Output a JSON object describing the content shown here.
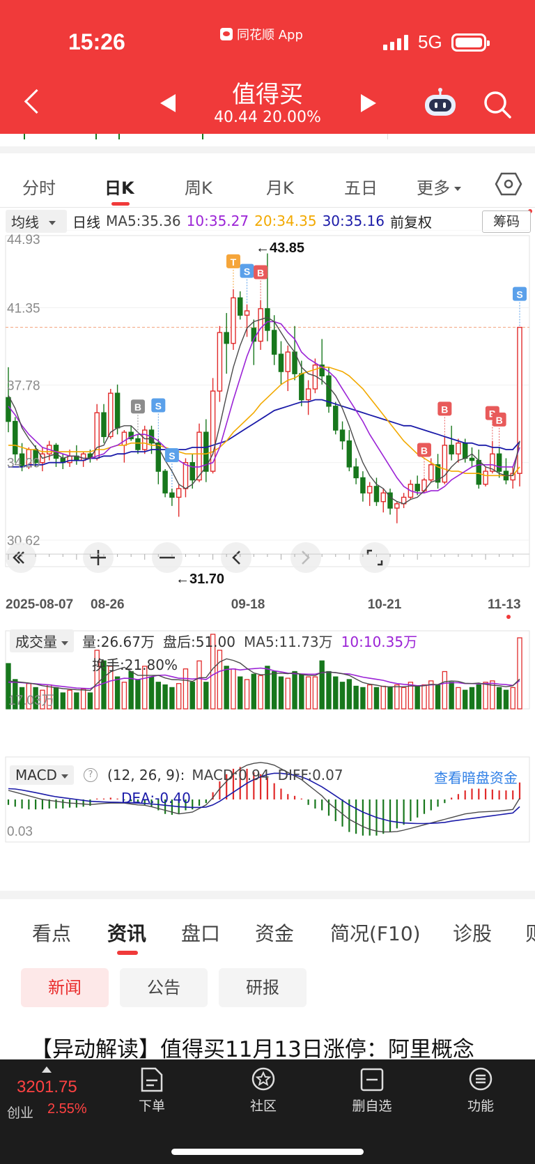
{
  "status_bar": {
    "time": "15:26",
    "app_name": "同花顺 App",
    "network": "5G"
  },
  "header": {
    "stock_name": "值得买",
    "stock_price_line": "40.44 20.00%"
  },
  "kline_tabs": [
    "分时",
    "日K",
    "周K",
    "月K",
    "五日",
    "更多"
  ],
  "active_kline_tab": "日K",
  "ma_row": {
    "dropdown": "均线",
    "period": "日线",
    "ma5": "MA5:35.36",
    "ma10": "10:35.27",
    "ma20": "20:34.35",
    "ma30": "30:35.16",
    "adjust": "前复权",
    "chips_button": "筹码"
  },
  "price_chart": {
    "y_labels": [
      "44.93",
      "41.35",
      "37.78",
      "34.20",
      "30.62"
    ],
    "high_label": "←43.85",
    "low_label": "←31.70",
    "x_labels": [
      "2025-08-07",
      "08-26",
      "09-18",
      "10-21",
      "11-13"
    ]
  },
  "volume_row": {
    "dropdown": "成交量",
    "volume": "量:26.67万",
    "after_hours": "盘后:51.00",
    "ma5": "MA5:11.73万",
    "ma10": "10:10.35万",
    "turnover": "换手:21.80%",
    "y_label": "17.03万"
  },
  "macd_row": {
    "dropdown": "MACD",
    "params": "(12, 26, 9):",
    "macd": "MACD:0.94",
    "diff": "DIFF:0.07",
    "dea": "DEA:-0.40",
    "link": "查看暗盘资金",
    "y_label": "0.03"
  },
  "section_tabs": [
    "看点",
    "资讯",
    "盘口",
    "资金",
    "简况(F10)",
    "诊股",
    "则"
  ],
  "active_section_tab": "资讯",
  "news_pills": [
    "新闻",
    "公告",
    "研报"
  ],
  "active_news_pill": "新闻",
  "headline": "【异动解读】值得买11月13日涨停：阿里概念",
  "bottom_bar": {
    "index_value": "3201.75",
    "index_name": "创业",
    "index_change": "2.55%",
    "nav": [
      "下单",
      "社区",
      "删自选",
      "功能"
    ]
  },
  "colors": {
    "up": "#e12b2b",
    "down": "#17771c",
    "ma5": "#4a4a4a",
    "ma10": "#9b23d6",
    "ma20": "#f2a900",
    "ma30": "#1a1aa8",
    "brand": "#f03a3a"
  },
  "chart_data": {
    "type": "candlestick",
    "dates_shown": [
      "2025-08-07",
      "08-26",
      "09-18",
      "10-21",
      "11-13"
    ],
    "candles": [
      [
        37.2,
        38.6,
        35.6,
        36.1
      ],
      [
        36.1,
        36.3,
        34.2,
        34.6
      ],
      [
        34.6,
        35.1,
        33.8,
        34.0
      ],
      [
        34.0,
        34.9,
        33.9,
        34.8
      ],
      [
        34.8,
        35.0,
        34.0,
        34.2
      ],
      [
        34.2,
        34.9,
        33.8,
        34.6
      ],
      [
        34.6,
        35.2,
        34.3,
        35.0
      ],
      [
        35.0,
        35.1,
        34.0,
        34.4
      ],
      [
        34.4,
        34.6,
        33.9,
        34.2
      ],
      [
        34.2,
        34.8,
        34.0,
        34.5
      ],
      [
        34.5,
        35.0,
        34.1,
        34.3
      ],
      [
        34.3,
        34.7,
        34.0,
        34.6
      ],
      [
        34.6,
        34.8,
        34.2,
        34.4
      ],
      [
        34.4,
        36.9,
        34.3,
        36.5
      ],
      [
        36.5,
        36.9,
        35.1,
        35.4
      ],
      [
        35.4,
        37.6,
        35.3,
        37.4
      ],
      [
        37.4,
        37.8,
        35.5,
        35.8
      ],
      [
        35.0,
        35.7,
        34.2,
        35.6
      ],
      [
        35.6,
        35.9,
        35.2,
        35.3
      ],
      [
        35.3,
        35.5,
        34.6,
        34.8
      ],
      [
        34.8,
        35.9,
        34.6,
        35.7
      ],
      [
        35.7,
        35.9,
        34.6,
        35.1
      ],
      [
        35.1,
        35.3,
        33.2,
        33.8
      ],
      [
        33.8,
        33.9,
        32.6,
        32.8
      ],
      [
        32.8,
        33.0,
        32.2,
        32.6
      ],
      [
        32.6,
        33.2,
        31.7,
        33.0
      ],
      [
        33.0,
        34.4,
        32.6,
        34.2
      ],
      [
        34.2,
        34.6,
        33.0,
        33.4
      ],
      [
        33.4,
        36.0,
        33.3,
        35.6
      ],
      [
        35.6,
        36.2,
        33.3,
        33.8
      ],
      [
        33.8,
        38.1,
        33.7,
        37.5
      ],
      [
        37.5,
        40.5,
        37.0,
        40.2
      ],
      [
        40.2,
        41.1,
        38.3,
        39.7
      ],
      [
        39.7,
        42.2,
        39.4,
        41.8
      ],
      [
        41.8,
        42.1,
        40.8,
        41.0
      ],
      [
        41.0,
        41.5,
        40.0,
        41.2
      ],
      [
        40.4,
        40.8,
        38.7,
        39.8
      ],
      [
        39.8,
        41.7,
        39.4,
        41.3
      ],
      [
        41.3,
        43.85,
        39.8,
        40.3
      ],
      [
        40.3,
        41.0,
        38.7,
        39.2
      ],
      [
        39.2,
        39.8,
        37.8,
        38.4
      ],
      [
        38.4,
        39.6,
        37.5,
        39.3
      ],
      [
        39.3,
        40.5,
        38.0,
        38.3
      ],
      [
        38.3,
        38.9,
        36.8,
        37.1
      ],
      [
        37.1,
        38.0,
        36.4,
        37.6
      ],
      [
        37.6,
        39.0,
        37.4,
        38.7
      ],
      [
        38.7,
        39.9,
        37.8,
        38.2
      ],
      [
        38.2,
        38.6,
        36.5,
        36.8
      ],
      [
        36.8,
        37.0,
        35.5,
        35.7
      ],
      [
        35.7,
        36.1,
        34.8,
        35.2
      ],
      [
        35.2,
        35.7,
        33.8,
        34.0
      ],
      [
        34.0,
        34.4,
        33.2,
        33.5
      ],
      [
        33.5,
        33.8,
        32.4,
        32.8
      ],
      [
        32.8,
        33.3,
        32.2,
        33.1
      ],
      [
        33.1,
        33.5,
        32.2,
        32.4
      ],
      [
        32.4,
        33.0,
        31.9,
        32.8
      ],
      [
        32.8,
        33.0,
        31.8,
        32.1
      ],
      [
        32.1,
        32.4,
        31.4,
        32.3
      ],
      [
        32.3,
        32.8,
        32.1,
        32.6
      ],
      [
        32.6,
        33.4,
        32.5,
        33.2
      ],
      [
        33.2,
        33.6,
        32.7,
        32.9
      ],
      [
        32.9,
        33.5,
        32.8,
        33.4
      ],
      [
        33.4,
        34.4,
        33.3,
        34.1
      ],
      [
        34.1,
        34.6,
        33.0,
        33.3
      ],
      [
        33.3,
        35.4,
        33.2,
        35.0
      ],
      [
        35.0,
        35.9,
        34.3,
        34.6
      ],
      [
        34.6,
        35.3,
        34.2,
        35.1
      ],
      [
        35.1,
        35.3,
        34.2,
        34.4
      ],
      [
        34.4,
        34.9,
        34.0,
        34.3
      ],
      [
        34.3,
        34.8,
        33.0,
        33.2
      ],
      [
        33.2,
        34.0,
        33.1,
        33.8
      ],
      [
        33.8,
        35.2,
        33.7,
        34.6
      ],
      [
        34.6,
        34.9,
        33.5,
        33.8
      ],
      [
        33.8,
        34.4,
        33.2,
        33.4
      ],
      [
        33.4,
        34.0,
        33.0,
        33.7
      ],
      [
        33.7,
        40.44,
        33.1,
        40.44
      ]
    ],
    "ma5": [
      37.3,
      36.7,
      35.8,
      35.3,
      34.9,
      34.4,
      34.5,
      34.6,
      34.4,
      34.5,
      34.5,
      34.4,
      34.4,
      34.9,
      35.0,
      35.6,
      35.8,
      35.9,
      35.9,
      35.6,
      35.3,
      35.3,
      34.9,
      34.3,
      33.8,
      33.2,
      33.0,
      33.2,
      33.6,
      34.0,
      34.6,
      35.9,
      37.3,
      38.6,
      39.6,
      40.4,
      40.7,
      40.8,
      40.9,
      40.7,
      40.2,
      39.7,
      39.3,
      38.6,
      38.3,
      38.2,
      38.0,
      37.7,
      37.3,
      36.7,
      35.9,
      35.0,
      34.2,
      33.6,
      33.2,
      33.0,
      32.6,
      32.4,
      32.3,
      32.5,
      32.6,
      32.9,
      33.3,
      33.4,
      33.6,
      34.0,
      34.3,
      34.4,
      34.6,
      34.3,
      34.0,
      33.9,
      33.7,
      33.6,
      33.6,
      35.2
    ],
    "ma10": [
      36.8,
      36.4,
      35.9,
      35.5,
      35.2,
      34.9,
      34.8,
      34.7,
      34.6,
      34.5,
      34.5,
      34.4,
      34.4,
      34.5,
      34.6,
      34.9,
      35.0,
      35.2,
      35.4,
      35.5,
      35.5,
      35.4,
      35.2,
      34.9,
      34.6,
      34.3,
      34.1,
      34.0,
      34.0,
      34.1,
      34.2,
      34.9,
      36.0,
      37.1,
      38.1,
      39.1,
      39.9,
      40.4,
      40.7,
      40.7,
      40.6,
      40.2,
      39.9,
      39.3,
      39.0,
      38.8,
      38.6,
      38.4,
      38.1,
      37.6,
      37.1,
      36.6,
      36.1,
      35.5,
      35.0,
      34.5,
      34.0,
      33.5,
      33.1,
      32.9,
      32.8,
      32.8,
      32.9,
      32.9,
      33.1,
      33.4,
      33.6,
      33.8,
      34.0,
      34.1,
      34.1,
      34.1,
      34.0,
      34.0,
      34.0,
      34.9
    ],
    "ma20": [
      35.0,
      35.0,
      34.9,
      34.8,
      34.8,
      34.7,
      34.7,
      34.7,
      34.7,
      34.7,
      34.7,
      34.7,
      34.7,
      34.8,
      34.8,
      34.9,
      35.0,
      35.0,
      35.1,
      35.1,
      35.1,
      35.0,
      35.0,
      34.9,
      34.8,
      34.7,
      34.6,
      34.6,
      34.6,
      34.6,
      34.7,
      34.9,
      35.2,
      35.6,
      35.9,
      36.2,
      36.5,
      36.9,
      37.2,
      37.5,
      37.8,
      38.0,
      38.1,
      38.3,
      38.4,
      38.5,
      38.6,
      38.6,
      38.5,
      38.4,
      38.2,
      37.9,
      37.6,
      37.2,
      36.8,
      36.4,
      36.0,
      35.6,
      35.2,
      34.9,
      34.6,
      34.4,
      34.2,
      34.0,
      33.9,
      33.8,
      33.8,
      33.7,
      33.7,
      33.7,
      33.6,
      33.6,
      33.6,
      33.6,
      33.6,
      34.0
    ],
    "ma30": [
      34.0,
      34.0,
      34.0,
      34.1,
      34.1,
      34.1,
      34.2,
      34.2,
      34.2,
      34.3,
      34.3,
      34.3,
      34.4,
      34.4,
      34.5,
      34.5,
      34.6,
      34.6,
      34.7,
      34.7,
      34.7,
      34.8,
      34.8,
      34.8,
      34.8,
      34.8,
      34.8,
      34.9,
      34.9,
      34.9,
      35.0,
      35.1,
      35.2,
      35.4,
      35.6,
      35.8,
      36.0,
      36.2,
      36.4,
      36.6,
      36.7,
      36.8,
      36.9,
      37.0,
      37.0,
      37.1,
      37.1,
      37.0,
      36.9,
      36.8,
      36.7,
      36.6,
      36.5,
      36.4,
      36.3,
      36.2,
      36.1,
      36.0,
      35.9,
      35.9,
      35.8,
      35.7,
      35.6,
      35.5,
      35.4,
      35.3,
      35.2,
      35.1,
      35.1,
      35.0,
      35.0,
      34.9,
      34.9,
      34.8,
      34.8,
      35.16
    ],
    "volume_wan": [
      17.0,
      11.0,
      8.0,
      9.5,
      8.0,
      7.0,
      9.0,
      8.0,
      6.0,
      7.0,
      6.0,
      7.5,
      6.0,
      22.0,
      18.0,
      16.0,
      12.0,
      10.0,
      14.0,
      11.0,
      16.0,
      12.0,
      10.0,
      9.0,
      8.0,
      9.5,
      15.0,
      10.0,
      18.0,
      10.0,
      28.0,
      22.0,
      16.0,
      15.0,
      12.0,
      11.0,
      13.0,
      12.5,
      16.0,
      14.0,
      12.0,
      11.5,
      14.0,
      13.0,
      12.0,
      12.0,
      18.0,
      14.0,
      12.0,
      10.0,
      11.0,
      8.5,
      8.0,
      9.0,
      8.0,
      8.5,
      8.0,
      9.0,
      8.0,
      10.0,
      8.5,
      9.0,
      10.5,
      9.0,
      14.0,
      10.0,
      8.0,
      7.0,
      8.0,
      9.0,
      10.0,
      10.5,
      8.0,
      7.0,
      8.0,
      26.67
    ],
    "vol_ma5": [
      10.5,
      10.2,
      10.0,
      9.7,
      9.3,
      8.7,
      8.3,
      8.0,
      7.6,
      7.4,
      7.2,
      7.1,
      6.9,
      9.5,
      11.9,
      13.9,
      14.8,
      15.6,
      14.0,
      12.6,
      12.6,
      12.6,
      12.6,
      11.6,
      11.0,
      10.9,
      10.7,
      10.3,
      11.7,
      11.7,
      15.1,
      17.6,
      18.8,
      18.2,
      17.2,
      15.2,
      13.5,
      12.8,
      12.9,
      13.3,
      13.4,
      13.2,
      13.6,
      12.9,
      12.6,
      12.5,
      13.8,
      13.8,
      13.6,
      13.2,
      12.6,
      11.2,
      9.9,
      9.3,
      8.9,
      8.4,
      8.3,
      8.3,
      8.3,
      8.6,
      8.5,
      8.7,
      9.2,
      9.1,
      10.2,
      10.5,
      10.3,
      9.6,
      9.5,
      9.7,
      9.2,
      8.9,
      8.7,
      8.3,
      8.7,
      11.2
    ],
    "vol_ma10": [
      10.0,
      10.0,
      9.8,
      9.6,
      9.4,
      9.2,
      9.0,
      8.7,
      8.4,
      8.1,
      7.8,
      7.7,
      7.6,
      8.7,
      9.6,
      10.5,
      11.0,
      11.5,
      11.4,
      11.0,
      11.5,
      12.1,
      12.6,
      12.7,
      12.1,
      11.5,
      11.4,
      11.2,
      11.4,
      11.0,
      12.8,
      14.1,
      14.8,
      15.0,
      14.6,
      14.9,
      15.1,
      15.3,
      15.0,
      14.3,
      13.9,
      13.4,
      13.2,
      13.1,
      13.0,
      13.0,
      13.6,
      13.8,
      13.6,
      13.2,
      13.1,
      12.5,
      11.9,
      11.5,
      11.1,
      10.7,
      10.0,
      9.5,
      9.2,
      9.0,
      8.7,
      8.8,
      9.0,
      9.1,
      9.6,
      9.8,
      9.8,
      9.5,
      9.5,
      9.4,
      9.5,
      9.6,
      9.3,
      9.1,
      8.8,
      10.6
    ],
    "macd_hist": [
      -0.3,
      -0.4,
      -0.5,
      -0.55,
      -0.55,
      -0.55,
      -0.5,
      -0.5,
      -0.5,
      -0.45,
      -0.45,
      -0.4,
      -0.35,
      0.05,
      0.05,
      0.1,
      0.05,
      -0.05,
      -0.1,
      -0.2,
      -0.3,
      -0.4,
      -0.6,
      -0.8,
      -0.85,
      -0.8,
      -0.6,
      -0.55,
      -0.35,
      -0.2,
      0.4,
      1.0,
      1.4,
      1.7,
      1.8,
      1.7,
      1.5,
      1.4,
      1.2,
      0.9,
      0.6,
      0.3,
      0.2,
      0.05,
      -0.3,
      -0.5,
      -0.6,
      -0.9,
      -1.2,
      -1.5,
      -1.8,
      -1.9,
      -2.0,
      -2.0,
      -2.0,
      -1.9,
      -1.8,
      -1.6,
      -1.4,
      -1.2,
      -1.0,
      -0.8,
      -0.6,
      -0.4,
      -0.2,
      0.1,
      0.3,
      0.5,
      0.6,
      0.6,
      0.6,
      0.55,
      0.5,
      0.5,
      0.5,
      0.94
    ],
    "diff": [
      0.5,
      0.4,
      0.3,
      0.2,
      0.1,
      0.0,
      -0.05,
      -0.1,
      -0.15,
      -0.2,
      -0.22,
      -0.25,
      -0.28,
      -0.25,
      -0.22,
      -0.2,
      -0.2,
      -0.2,
      -0.25,
      -0.3,
      -0.32,
      -0.4,
      -0.5,
      -0.6,
      -0.7,
      -0.8,
      -0.75,
      -0.7,
      -0.5,
      -0.3,
      0.1,
      0.6,
      1.0,
      1.4,
      1.7,
      1.9,
      2.0,
      2.05,
      2.0,
      1.9,
      1.7,
      1.5,
      1.3,
      1.1,
      0.8,
      0.5,
      0.2,
      -0.2,
      -0.5,
      -0.8,
      -1.1,
      -1.3,
      -1.5,
      -1.65,
      -1.75,
      -1.8,
      -1.8,
      -1.78,
      -1.7,
      -1.6,
      -1.5,
      -1.4,
      -1.3,
      -1.2,
      -1.1,
      -1.0,
      -0.9,
      -0.8,
      -0.75,
      -0.7,
      -0.68,
      -0.66,
      -0.64,
      -0.6,
      -0.55,
      0.07
    ],
    "dea": [
      0.6,
      0.58,
      0.52,
      0.45,
      0.38,
      0.3,
      0.22,
      0.15,
      0.1,
      0.05,
      0.0,
      -0.05,
      -0.1,
      -0.12,
      -0.14,
      -0.15,
      -0.16,
      -0.17,
      -0.18,
      -0.2,
      -0.22,
      -0.25,
      -0.28,
      -0.32,
      -0.36,
      -0.4,
      -0.42,
      -0.44,
      -0.44,
      -0.42,
      -0.3,
      -0.1,
      0.15,
      0.4,
      0.65,
      0.9,
      1.1,
      1.25,
      1.38,
      1.45,
      1.45,
      1.4,
      1.35,
      1.25,
      1.1,
      0.9,
      0.7,
      0.45,
      0.2,
      -0.05,
      -0.3,
      -0.5,
      -0.7,
      -0.85,
      -1.0,
      -1.1,
      -1.2,
      -1.25,
      -1.3,
      -1.32,
      -1.33,
      -1.33,
      -1.32,
      -1.3,
      -1.27,
      -1.2,
      -1.15,
      -1.1,
      -1.05,
      -1.0,
      -0.95,
      -0.9,
      -0.85,
      -0.8,
      -0.75,
      -0.4
    ],
    "signals": [
      {
        "index": 19,
        "label": "B",
        "color": "#8c8c8c"
      },
      {
        "index": 22,
        "label": "S",
        "color": "#5aa0ea"
      },
      {
        "index": 24,
        "label": "S",
        "color": "#5aa0ea"
      },
      {
        "index": 33,
        "label": "T",
        "color": "#f5a53a"
      },
      {
        "index": 35,
        "label": "S",
        "color": "#5aa0ea"
      },
      {
        "index": 37,
        "label": "B",
        "color": "#e85a5a"
      },
      {
        "index": 61,
        "label": "B",
        "color": "#e85a5a"
      },
      {
        "index": 64,
        "label": "B",
        "color": "#e85a5a"
      },
      {
        "index": 71,
        "label": "B",
        "color": "#e85a5a"
      },
      {
        "index": 72,
        "label": "B",
        "color": "#e85a5a"
      },
      {
        "index": 75,
        "label": "S",
        "color": "#5aa0ea"
      }
    ],
    "price_range": [
      30.62,
      44.93
    ],
    "volume_range": [
      0,
      28
    ],
    "macd_range": [
      -2.2,
      2.2
    ]
  }
}
